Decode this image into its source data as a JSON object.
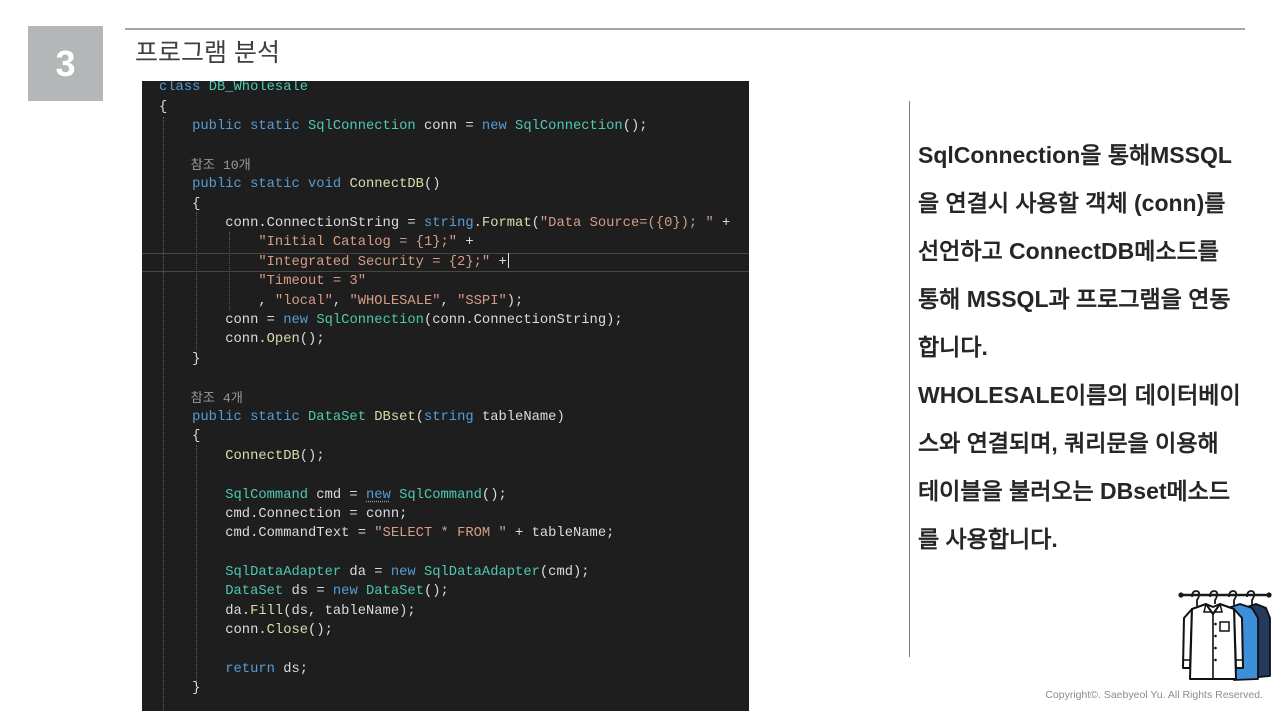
{
  "slide": {
    "section_number": "3",
    "title": "프로그램 분석"
  },
  "code": {
    "lines": [
      {
        "tokens": [
          [
            "class ",
            "#569cd6"
          ],
          [
            "DB_Wholesale",
            "#4ec9b0"
          ]
        ]
      },
      {
        "tokens": [
          [
            "{",
            "#dcdcdc"
          ]
        ]
      },
      {
        "tokens": [
          [
            "    public static ",
            "#569cd6"
          ],
          [
            "SqlConnection",
            "#4ec9b0"
          ],
          [
            " conn = ",
            "#dcdcdc"
          ],
          [
            "new ",
            "#569cd6"
          ],
          [
            "SqlConnection",
            "#4ec9b0"
          ],
          [
            "();",
            "#dcdcdc"
          ]
        ]
      },
      {
        "tokens": []
      },
      {
        "codelens": true,
        "tokens": [
          [
            "    참조 10개",
            "#999999"
          ]
        ]
      },
      {
        "tokens": [
          [
            "    public static void ",
            "#569cd6"
          ],
          [
            "ConnectDB",
            "#dcdcaa"
          ],
          [
            "()",
            "#dcdcdc"
          ]
        ]
      },
      {
        "tokens": [
          [
            "    {",
            "#dcdcdc"
          ]
        ]
      },
      {
        "tokens": [
          [
            "        conn.ConnectionString = ",
            "#dcdcdc"
          ],
          [
            "string",
            "#569cd6"
          ],
          [
            ".",
            "#dcdcdc"
          ],
          [
            "Format",
            "#dcdcaa"
          ],
          [
            "(",
            "#dcdcdc"
          ],
          [
            "\"Data Source=({0}); \"",
            "#d69d85"
          ],
          [
            " +",
            "#dcdcdc"
          ]
        ]
      },
      {
        "tokens": [
          [
            "            \"Initial Catalog = {1};\"",
            "#d69d85"
          ],
          [
            " +",
            "#dcdcdc"
          ]
        ]
      },
      {
        "current": true,
        "tokens": [
          [
            "            \"Integrated Security = {2};\"",
            "#d69d85"
          ],
          [
            " +",
            "#dcdcdc"
          ]
        ]
      },
      {
        "tokens": [
          [
            "            \"Timeout = 3\"",
            "#d69d85"
          ]
        ]
      },
      {
        "tokens": [
          [
            "            , ",
            "#dcdcdc"
          ],
          [
            "\"local\"",
            "#d69d85"
          ],
          [
            ", ",
            "#dcdcdc"
          ],
          [
            "\"WHOLESALE\"",
            "#d69d85"
          ],
          [
            ", ",
            "#dcdcdc"
          ],
          [
            "\"SSPI\"",
            "#d69d85"
          ],
          [
            ");",
            "#dcdcdc"
          ]
        ]
      },
      {
        "tokens": [
          [
            "        conn = ",
            "#dcdcdc"
          ],
          [
            "new ",
            "#569cd6"
          ],
          [
            "SqlConnection",
            "#4ec9b0"
          ],
          [
            "(conn.ConnectionString);",
            "#dcdcdc"
          ]
        ]
      },
      {
        "tokens": [
          [
            "        conn.",
            "#dcdcdc"
          ],
          [
            "Open",
            "#dcdcaa"
          ],
          [
            "();",
            "#dcdcdc"
          ]
        ]
      },
      {
        "tokens": [
          [
            "    }",
            "#dcdcdc"
          ]
        ]
      },
      {
        "tokens": []
      },
      {
        "codelens": true,
        "tokens": [
          [
            "    참조 4개",
            "#999999"
          ]
        ]
      },
      {
        "tokens": [
          [
            "    public static ",
            "#569cd6"
          ],
          [
            "DataSet",
            "#4ec9b0"
          ],
          [
            " DBset",
            "#dcdcaa"
          ],
          [
            "(",
            "#dcdcdc"
          ],
          [
            "string ",
            "#569cd6"
          ],
          [
            "tableName)",
            "#dcdcdc"
          ]
        ]
      },
      {
        "tokens": [
          [
            "    {",
            "#dcdcdc"
          ]
        ]
      },
      {
        "tokens": [
          [
            "        ConnectDB",
            "#dcdcaa"
          ],
          [
            "();",
            "#dcdcdc"
          ]
        ]
      },
      {
        "tokens": []
      },
      {
        "tokens": [
          [
            "        SqlCommand",
            "#4ec9b0"
          ],
          [
            " cmd = ",
            "#dcdcdc"
          ],
          [
            "new",
            "#569cd6",
            true
          ],
          [
            " SqlCommand",
            "#4ec9b0"
          ],
          [
            "();",
            "#dcdcdc"
          ]
        ]
      },
      {
        "tokens": [
          [
            "        cmd.Connection = conn;",
            "#dcdcdc"
          ]
        ]
      },
      {
        "tokens": [
          [
            "        cmd.CommandText = ",
            "#dcdcdc"
          ],
          [
            "\"SELECT * FROM \"",
            "#d69d85"
          ],
          [
            " + tableName;",
            "#dcdcdc"
          ]
        ]
      },
      {
        "tokens": []
      },
      {
        "tokens": [
          [
            "        SqlDataAdapter",
            "#4ec9b0"
          ],
          [
            " da = ",
            "#dcdcdc"
          ],
          [
            "new ",
            "#569cd6"
          ],
          [
            "SqlDataAdapter",
            "#4ec9b0"
          ],
          [
            "(cmd);",
            "#dcdcdc"
          ]
        ]
      },
      {
        "tokens": [
          [
            "        DataSet",
            "#4ec9b0"
          ],
          [
            " ds = ",
            "#dcdcdc"
          ],
          [
            "new ",
            "#569cd6"
          ],
          [
            "DataSet",
            "#4ec9b0"
          ],
          [
            "();",
            "#dcdcdc"
          ]
        ]
      },
      {
        "tokens": [
          [
            "        da.",
            "#dcdcdc"
          ],
          [
            "Fill",
            "#dcdcaa"
          ],
          [
            "(ds, tableName);",
            "#dcdcdc"
          ]
        ]
      },
      {
        "tokens": [
          [
            "        conn.",
            "#dcdcdc"
          ],
          [
            "Close",
            "#dcdcaa"
          ],
          [
            "();",
            "#dcdcdc"
          ]
        ]
      },
      {
        "tokens": []
      },
      {
        "tokens": [
          [
            "        return ",
            "#569cd6"
          ],
          [
            "ds;",
            "#dcdcdc"
          ]
        ]
      },
      {
        "tokens": [
          [
            "    }",
            "#dcdcdc"
          ]
        ]
      }
    ]
  },
  "description": {
    "lines": [
      "SqlConnection을 통해MSSQL",
      "을 연결시 사용할 객체 (conn)를",
      "선언하고 ConnectDB메소드를",
      "통해 MSSQL과 프로그램을 연동",
      "합니다.",
      "WHOLESALE이름의 데이터베이",
      "스와 연결되며, 쿼리문을 이용해",
      "테이블을 불러오는 DBset메소드",
      "를 사용합니다."
    ]
  },
  "footer": {
    "copyright": "Copyright©. Saebyeol Yu. All Rights Reserved."
  },
  "icons": {
    "corner_illustration": "clothes-rack-icon"
  },
  "theme": {
    "section_badge": "#b4b7b7",
    "editor_background": "#1e1e1e",
    "current_line_border": "#464646"
  }
}
